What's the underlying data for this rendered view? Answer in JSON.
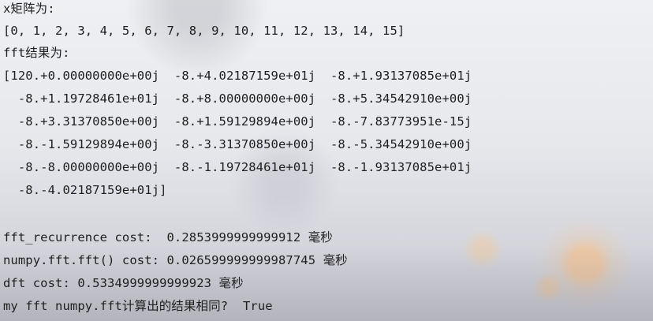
{
  "output": {
    "matrix_label": "x矩阵为:",
    "matrix_values": "[0, 1, 2, 3, 4, 5, 6, 7, 8, 9, 10, 11, 12, 13, 14, 15]",
    "fft_label": "fft结果为:",
    "fft_rows": [
      "[120.+0.00000000e+00j  -8.+4.02187159e+01j  -8.+1.93137085e+01j",
      "  -8.+1.19728461e+01j  -8.+8.00000000e+00j  -8.+5.34542910e+00j",
      "  -8.+3.31370850e+00j  -8.+1.59129894e+00j  -8.-7.83773951e-15j",
      "  -8.-1.59129894e+00j  -8.-3.31370850e+00j  -8.-5.34542910e+00j",
      "  -8.-8.00000000e+00j  -8.-1.19728461e+01j  -8.-1.93137085e+01j",
      "  -8.-4.02187159e+01j]"
    ],
    "timings": [
      "fft_recurrence cost:  0.2853999999999912 毫秒",
      "numpy.fft.fft() cost: 0.026599999999987745 毫秒",
      "dft cost: 0.5334999999999923 毫秒"
    ],
    "comparison": "my fft numpy.fft计算出的结果相同?  True"
  }
}
